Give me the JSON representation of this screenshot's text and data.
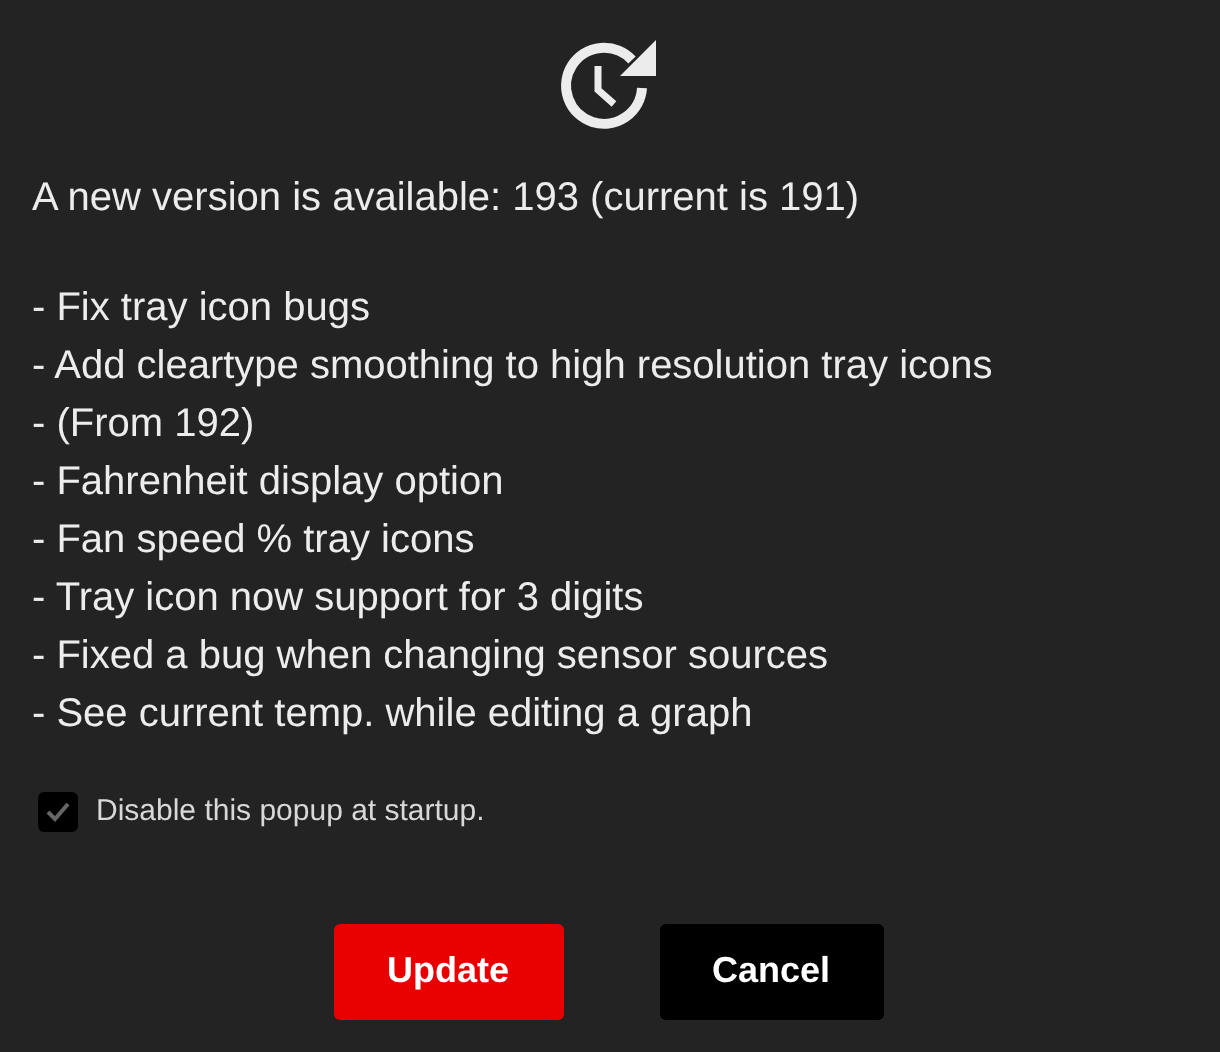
{
  "headline": "A new version is available: 193 (current is 191)",
  "changes": [
    "- Fix tray icon bugs",
    "- Add cleartype smoothing to high resolution tray icons",
    "- (From 192)",
    "- Fahrenheit display option",
    "- Fan speed % tray icons",
    "- Tray icon now support for 3 digits",
    "- Fixed a bug when changing sensor sources",
    "- See current temp. while editing a graph"
  ],
  "disable_popup": {
    "label": "Disable this popup at startup.",
    "checked": true
  },
  "buttons": [
    {
      "label": "Update",
      "kind": "primary"
    },
    {
      "label": "Cancel",
      "kind": "secondary"
    }
  ]
}
